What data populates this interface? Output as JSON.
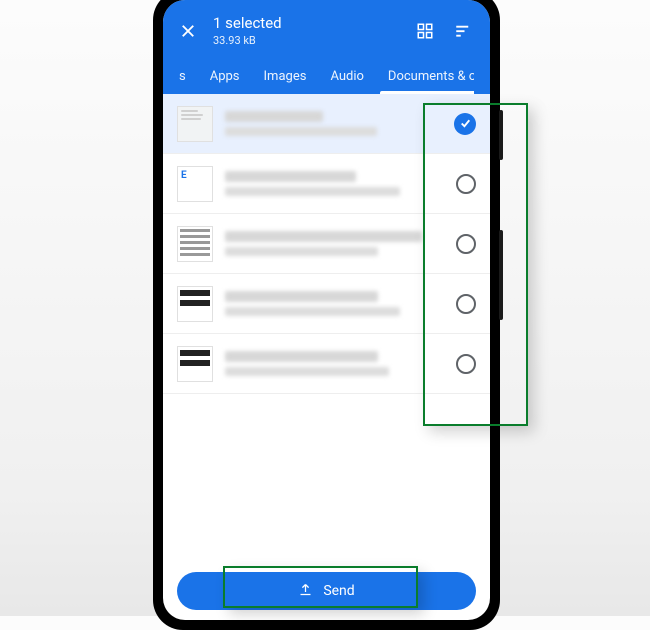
{
  "header": {
    "title": "1 selected",
    "subtitle": "33.93 kB"
  },
  "tabs": {
    "partial": "s",
    "items": [
      "Apps",
      "Images",
      "Audio",
      "Documents & other"
    ],
    "activeIndex": 3
  },
  "files": [
    {
      "selected": true,
      "thumb": "doc"
    },
    {
      "selected": false,
      "thumb": "blue-e"
    },
    {
      "selected": false,
      "thumb": "grid"
    },
    {
      "selected": false,
      "thumb": "barcode"
    },
    {
      "selected": false,
      "thumb": "barcode"
    }
  ],
  "send": {
    "label": "Send"
  }
}
